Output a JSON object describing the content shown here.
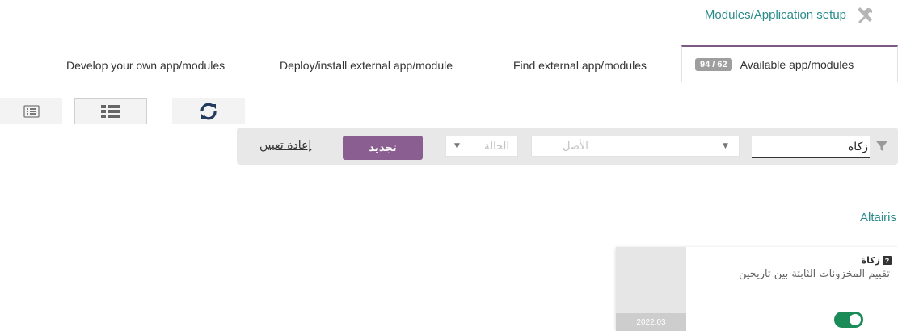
{
  "header": {
    "title": "Modules/Application setup",
    "icon": "tools-icon"
  },
  "tabs": [
    {
      "label": "Develop your own app/modules",
      "active": false
    },
    {
      "label": "Deploy/install external app/module",
      "active": false
    },
    {
      "label": "Find external app/modules",
      "active": false
    },
    {
      "label": "Available app/modules",
      "badge": "94 / 62",
      "active": true
    }
  ],
  "view_switcher": {
    "icons": [
      "list-view-icon",
      "compact-list-icon",
      "refresh-icon"
    ]
  },
  "filter": {
    "search_value": "زكاة",
    "origin_placeholder": "الأصل",
    "status_placeholder": "الحالة",
    "renew_label": "تجديد",
    "reset_label": "إعادة تعيين"
  },
  "section": {
    "title": "Altairis"
  },
  "module_card": {
    "name": "زكاة",
    "description": "تقييم المخزونات الثابتة بين تاريخين",
    "version": "2022.03",
    "enabled": true
  },
  "colors": {
    "accent": "#2a8b8b",
    "button": "#8b5e91",
    "toggle_on": "#1b8b58",
    "active_tab_border": "#7c5a85"
  }
}
